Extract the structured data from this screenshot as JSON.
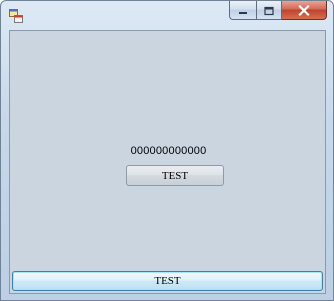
{
  "window": {
    "title": "",
    "icon": "winforms-app-icon",
    "controls": {
      "minimize": "minimize-icon",
      "maximize": "maximize-icon",
      "close": "close-icon"
    }
  },
  "form": {
    "number_label": "000000000000",
    "center_button_label": "TEST",
    "bottom_button_label": "TEST"
  },
  "colors": {
    "client_background": "#cad5e0",
    "close_button": "#c0432b",
    "focused_button_border": "#3c7fb1"
  }
}
